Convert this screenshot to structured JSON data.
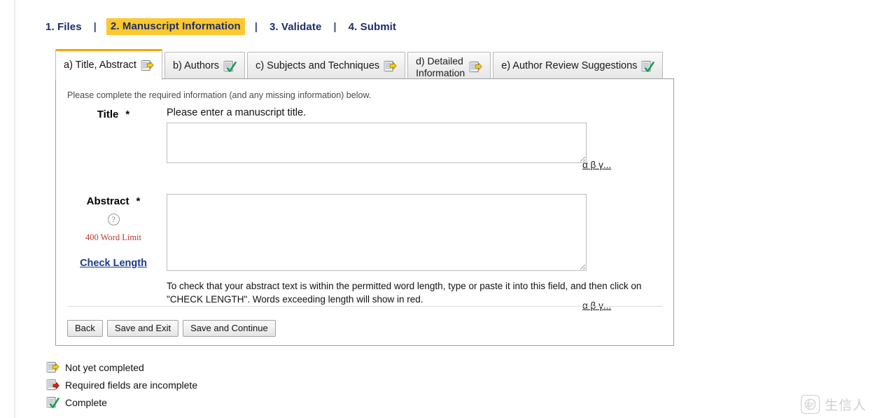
{
  "steps": {
    "separator": "|",
    "items": [
      {
        "label": "1. Files",
        "active": false
      },
      {
        "label": "2. Manuscript Information",
        "active": true
      },
      {
        "label": "3. Validate",
        "active": false
      },
      {
        "label": "4. Submit",
        "active": false
      }
    ],
    "active_highlight_color": "#fdc82f",
    "text_color": "#1d2d6b"
  },
  "tabs": [
    {
      "label": "a) Title, Abstract",
      "status_icon": "not-yet-completed-icon",
      "active": true
    },
    {
      "label": "b) Authors",
      "status_icon": "complete-icon",
      "active": false
    },
    {
      "label": "c) Subjects and Techniques",
      "status_icon": "not-yet-completed-icon",
      "active": false
    },
    {
      "label": "d) Detailed\nInformation",
      "status_icon": "not-yet-completed-icon",
      "active": false
    },
    {
      "label": "e) Author Review Suggestions",
      "status_icon": "complete-icon",
      "active": false
    }
  ],
  "form": {
    "intro": "Please complete the required information (and any missing information) below.",
    "required_marker": "*",
    "title": {
      "label": "Title",
      "prompt": "Please enter a manuscript title.",
      "value": "",
      "placeholder": "",
      "special_chars_link": "α β γ..."
    },
    "abstract": {
      "label": "Abstract",
      "help_glyph": "?",
      "word_limit": "400 Word Limit",
      "check_length_link": "Check Length",
      "value": "",
      "placeholder": "",
      "special_chars_link": "α β γ...",
      "hint": "To check that your abstract text is within the permitted word length, type or paste it into this field, and then click on \"CHECK LENGTH\". Words exceeding length will show in red."
    },
    "buttons": [
      {
        "label": "Back"
      },
      {
        "label": "Save and Exit"
      },
      {
        "label": "Save and Continue"
      }
    ]
  },
  "legend": [
    {
      "label": "Not yet completed",
      "icon": "not-yet-completed-icon",
      "marker_color": "#f2c50a"
    },
    {
      "label": "Required fields are incomplete",
      "icon": "required-incomplete-icon",
      "marker_color": "#d21f1f"
    },
    {
      "label": "Complete",
      "icon": "complete-icon",
      "marker_color": "#0f9d58"
    }
  ],
  "watermark": {
    "text": "生信人"
  },
  "colors": {
    "accent_gold": "#f5a800",
    "nav_navy": "#1d2d6b",
    "link_blue": "#1a3a8f",
    "warn_red": "#c0392b"
  }
}
